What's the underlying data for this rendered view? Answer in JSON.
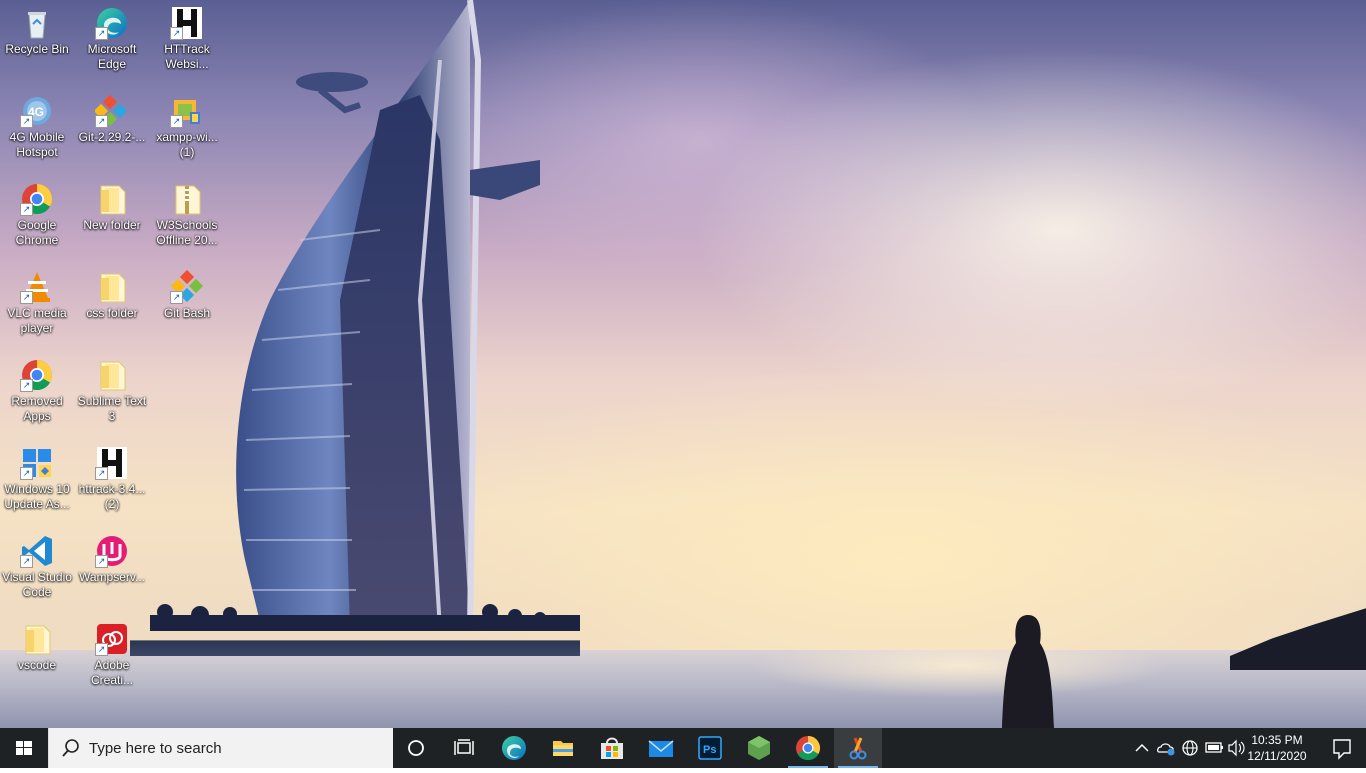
{
  "desktop": {
    "icons": [
      {
        "label": "Recycle Bin",
        "icon": "recycle-bin-icon"
      },
      {
        "label": "Microsoft Edge",
        "icon": "edge-icon"
      },
      {
        "label": "HTTrack Websi...",
        "icon": "httrack-icon"
      },
      {
        "label": "4G Mobile Hotspot",
        "icon": "hotspot-icon"
      },
      {
        "label": "Git-2.29.2-...",
        "icon": "git-installer-icon"
      },
      {
        "label": "xampp-wi... (1)",
        "icon": "xampp-installer-icon"
      },
      {
        "label": "Google Chrome",
        "icon": "chrome-icon"
      },
      {
        "label": "New folder",
        "icon": "folder-icon"
      },
      {
        "label": "W3Schools Offline 20...",
        "icon": "zip-folder-icon"
      },
      {
        "label": "VLC media player",
        "icon": "vlc-icon"
      },
      {
        "label": "css folder",
        "icon": "folder-icon"
      },
      {
        "label": "Git Bash",
        "icon": "git-bash-icon"
      },
      {
        "label": "Removed Apps",
        "icon": "chrome-icon"
      },
      {
        "label": "Sublime Text 3",
        "icon": "folder-icon"
      },
      {
        "label": "Windows 10 Update As...",
        "icon": "windows-update-icon"
      },
      {
        "label": "httrack-3.4... (2)",
        "icon": "httrack-icon"
      },
      {
        "label": "Visual Studio Code",
        "icon": "vscode-icon"
      },
      {
        "label": "Wampserv...",
        "icon": "wampserver-icon"
      },
      {
        "label": "vscode",
        "icon": "folder-icon"
      },
      {
        "label": "Adobe Creati...",
        "icon": "adobe-cc-icon"
      }
    ]
  },
  "taskbar": {
    "search_placeholder": "Type here to search",
    "apps": [
      "cortana",
      "task-view",
      "edge",
      "file-explorer",
      "microsoft-store",
      "mail",
      "photoshop",
      "node",
      "chrome",
      "snipping-tool"
    ],
    "clock": {
      "time": "10:35 PM",
      "date": "12/11/2020"
    }
  }
}
